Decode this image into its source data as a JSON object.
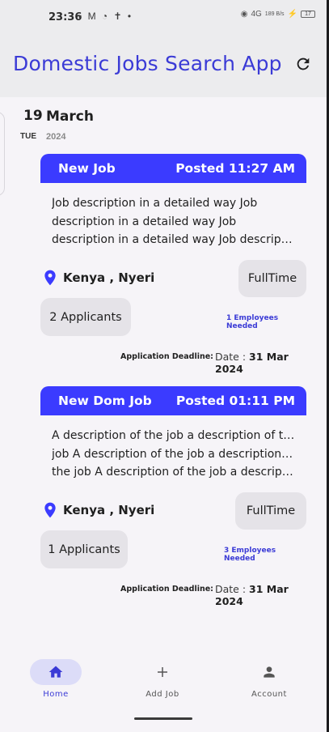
{
  "status_bar": {
    "time": "23:36",
    "left_icons": "▪ M ◔ ✝ •",
    "signal_text": "4G",
    "data_rate": "189 B/s",
    "battery": "17"
  },
  "header": {
    "title": "Domestic Jobs Search App",
    "refresh_icon": "refresh-icon"
  },
  "date": {
    "day": "19",
    "month": "March",
    "weekday": "TUE",
    "year": "2024"
  },
  "jobs": [
    {
      "title": "New Job",
      "posted": "Posted 11:27 AM",
      "description_lines": [
        "Job description in a detailed way Job",
        "description in a detailed way Job",
        "description in a detailed way Job descriptio..."
      ],
      "location": "Kenya , Nyeri",
      "job_type": "FullTime",
      "applicants": "2 Applicants",
      "employees_needed": "1 Employees Needed",
      "deadline_label": "Application Deadline:",
      "deadline_prefix": "Date : ",
      "deadline_date": "31 Mar 2024"
    },
    {
      "title": "New Dom Job",
      "posted": "Posted 01:11 PM",
      "description_lines": [
        "A description of the job a description of the",
        "job A description of the job a description of",
        "the job A description of the job a descriptio..."
      ],
      "location": "Kenya , Nyeri",
      "job_type": "FullTime",
      "applicants": "1 Applicants",
      "employees_needed": "3 Employees Needed",
      "deadline_label": "Application Deadline:",
      "deadline_prefix": "Date : ",
      "deadline_date": "31 Mar 2024"
    }
  ],
  "bottom_nav": {
    "items": [
      {
        "label": "Home",
        "icon": "home-icon",
        "active": true
      },
      {
        "label": "Add Job",
        "icon": "plus-icon",
        "active": false
      },
      {
        "label": "Account",
        "icon": "account-icon",
        "active": false
      }
    ]
  },
  "colors": {
    "accent": "#3b3bff",
    "title": "#3b3bd6",
    "pill": "#e5e3e8"
  }
}
